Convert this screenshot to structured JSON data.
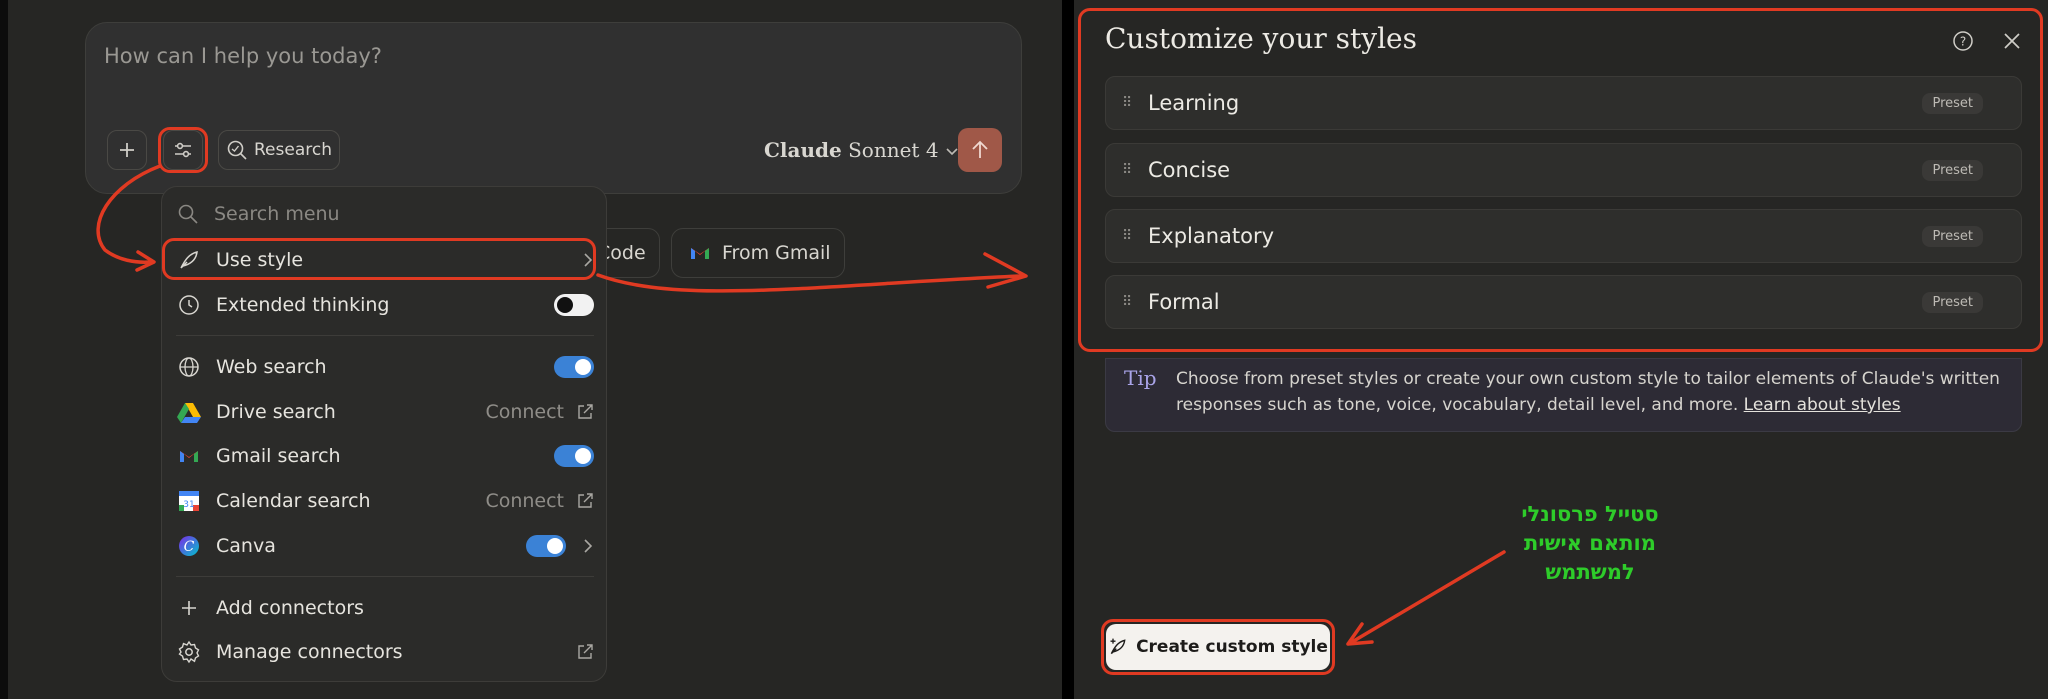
{
  "composer": {
    "placeholder": "How can I help you today?",
    "research_label": "Research",
    "model_brand": "Claude",
    "model_name": "Sonnet 4"
  },
  "chips": {
    "code_partial": "Code",
    "gmail": "From Gmail"
  },
  "menu": {
    "search_placeholder": "Search menu",
    "items": [
      {
        "label": "Use style",
        "icon": "feather-icon",
        "control": "chevron"
      },
      {
        "label": "Extended thinking",
        "icon": "clock-icon",
        "control": "toggle-off"
      },
      {
        "label": "Web search",
        "icon": "globe-icon",
        "control": "toggle-on"
      },
      {
        "label": "Drive search",
        "icon": "google-drive-icon",
        "control": "connect",
        "connect_label": "Connect"
      },
      {
        "label": "Gmail search",
        "icon": "gmail-icon",
        "control": "toggle-on"
      },
      {
        "label": "Calendar search",
        "icon": "google-calendar-icon",
        "control": "connect",
        "connect_label": "Connect"
      },
      {
        "label": "Canva",
        "icon": "canva-icon",
        "control": "toggle-on-chevron"
      },
      {
        "label": "Add connectors",
        "icon": "plus-icon",
        "control": "none"
      },
      {
        "label": "Manage connectors",
        "icon": "gear-icon",
        "control": "external"
      }
    ]
  },
  "styles_panel": {
    "title": "Customize your styles",
    "styles": [
      {
        "name": "Learning",
        "badge": "Preset"
      },
      {
        "name": "Concise",
        "badge": "Preset"
      },
      {
        "name": "Explanatory",
        "badge": "Preset"
      },
      {
        "name": "Formal",
        "badge": "Preset"
      }
    ],
    "tip_label": "Tip",
    "tip_text": "Choose from preset styles or create your own custom style to tailor elements of Claude's written responses such as tone, voice, vocabulary, detail level, and more.",
    "tip_link": "Learn about styles",
    "create_button": "Create custom style"
  },
  "annotation": {
    "line1": "סטייל פרסונלי",
    "line2": "מותאם אישית",
    "line3": "למשתמש"
  },
  "colors": {
    "background": "#262624",
    "accent_send": "#a05848",
    "highlight": "#e03a22",
    "toggle_on": "#3b82d6",
    "annotation_text": "#2ecc2a"
  }
}
